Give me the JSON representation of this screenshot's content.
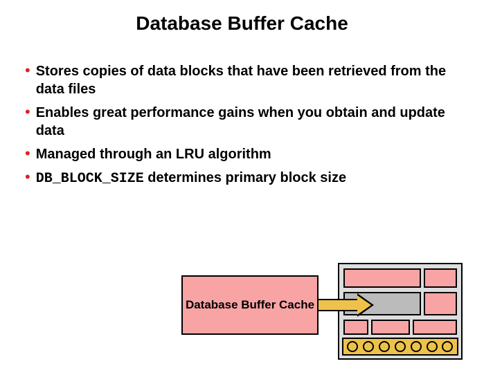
{
  "title": "Database Buffer Cache",
  "bullets": [
    {
      "text": "Stores copies of data blocks that have been retrieved from the data files"
    },
    {
      "text": "Enables great performance gains when you obtain and update data"
    },
    {
      "text": "Managed through an LRU algorithm"
    },
    {
      "code": "DB_BLOCK_SIZE",
      "text_after": " determines primary block size"
    }
  ],
  "diagram": {
    "label": "Database Buffer Cache",
    "pointer_color": "#eec24a",
    "block_color": "#f8a4a4",
    "circle_count": 7
  }
}
